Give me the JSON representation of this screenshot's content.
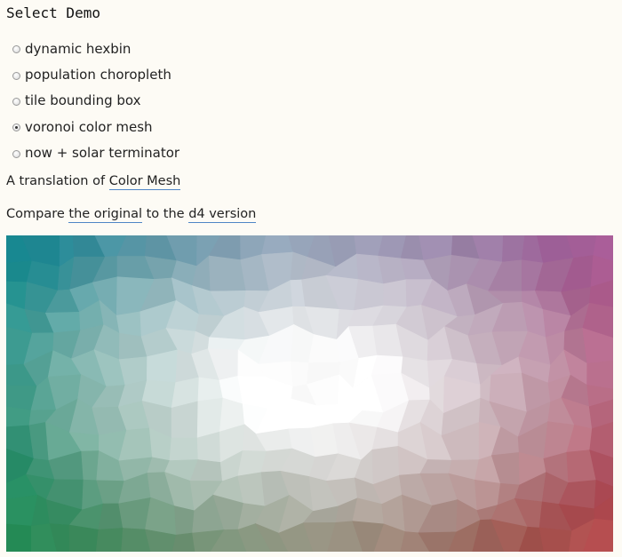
{
  "header": {
    "title": "Select Demo"
  },
  "demos": [
    {
      "label": "dynamic hexbin",
      "checked": false
    },
    {
      "label": "population choropleth",
      "checked": false
    },
    {
      "label": "tile bounding box",
      "checked": false
    },
    {
      "label": "voronoi color mesh",
      "checked": true
    },
    {
      "label": "now + solar terminator",
      "checked": false
    }
  ],
  "translation": {
    "prefix": "A translation of ",
    "link": "Color Mesh"
  },
  "compare": {
    "prefix": "Compare ",
    "link1": "the original",
    "middle": " to the ",
    "link2": "d4 version"
  },
  "mesh": {
    "colors": {
      "top_left": "#06848f",
      "top_right": "#a04a8e",
      "bottom_left": "#0f8245",
      "bottom_right": "#b03a3a",
      "center": "#ffffff"
    }
  }
}
